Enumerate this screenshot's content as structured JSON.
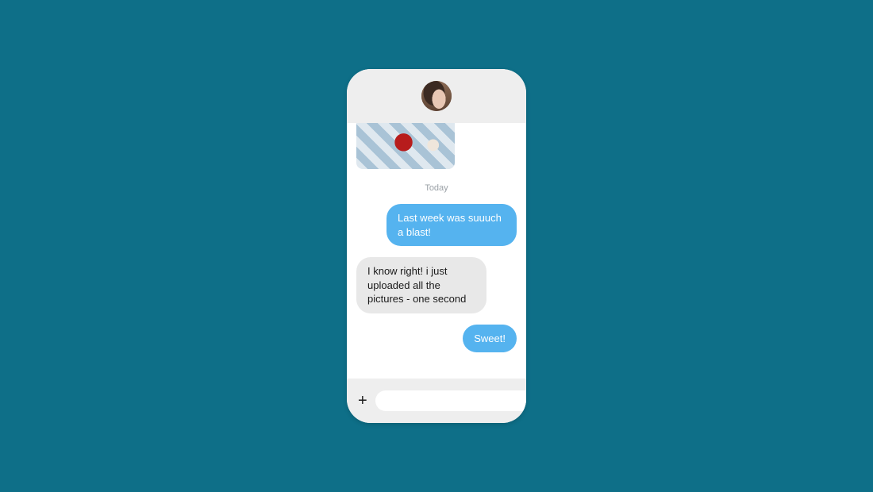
{
  "header": {
    "avatar_name": "contact-avatar"
  },
  "divider_label": "Today",
  "messages": [
    {
      "kind": "image",
      "side": "received"
    },
    {
      "kind": "text",
      "side": "sent",
      "text": "Last week was suuuch a blast!"
    },
    {
      "kind": "text",
      "side": "received",
      "text": "I know right! i just uploaded all the pictures - one second"
    },
    {
      "kind": "text",
      "side": "sent",
      "text": "Sweet!"
    }
  ],
  "composer": {
    "input_placeholder": "",
    "input_value": ""
  },
  "colors": {
    "page_bg": "#0e6f88",
    "sent_bubble": "#55b3ef",
    "received_bubble": "#e8e8e8"
  },
  "icons": {
    "add": "plus-icon",
    "send": "paper-plane-icon"
  }
}
